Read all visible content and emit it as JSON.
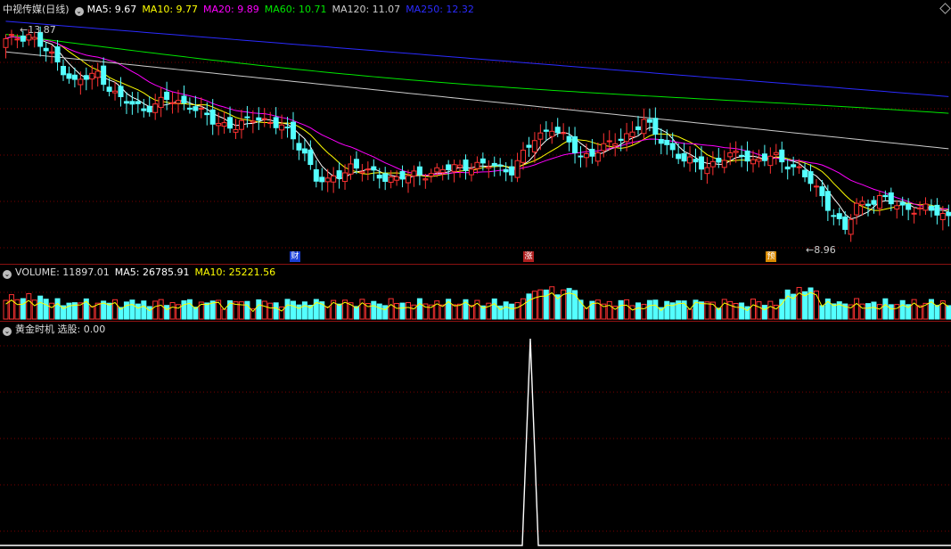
{
  "main_legend": {
    "title": "中视传媒(日线)",
    "ma5": "MA5: 9.67",
    "ma10": "MA10: 9.77",
    "ma20": "MA20: 9.89",
    "ma60": "MA60: 10.71",
    "ma120": "MA120: 11.07",
    "ma250": "MA250: 12.32"
  },
  "volume_legend": {
    "title": "VOLUME: 11897.01",
    "ma5": "MA5: 26785.91",
    "ma10": "MA10: 25221.56"
  },
  "indicator_legend": {
    "title": "黄金时机 选股: 0.00"
  },
  "annotations": {
    "high": "13.87",
    "low": "8.96"
  },
  "events": [
    "财",
    "涨",
    "预"
  ],
  "icons": {
    "collapse": "chevron-circle-icon",
    "corner": "diamond-icon"
  },
  "colors": {
    "up": "#ff3232",
    "down": "#54ffff",
    "ma5": "#ffffff",
    "ma10": "#ffff00",
    "ma20": "#ff00ff",
    "ma60": "#00e600",
    "ma120": "#cccccc",
    "ma250": "#2b2bff",
    "grid": "#7a0000",
    "indicator": "#ffffff"
  },
  "chart_data": [
    {
      "type": "candlestick",
      "series": [
        {
          "name": "MA5",
          "value": 9.67
        },
        {
          "name": "MA10",
          "value": 9.77
        },
        {
          "name": "MA20",
          "value": 9.89
        },
        {
          "name": "MA60",
          "value": 10.71
        },
        {
          "name": "MA120",
          "value": 11.07
        },
        {
          "name": "MA250",
          "value": 12.32
        }
      ],
      "ylim": [
        8.7,
        14.2
      ],
      "highlights": {
        "max": 13.87,
        "min": 8.96
      }
    },
    {
      "type": "bar",
      "series": [
        {
          "name": "VOLUME",
          "value": 11897.01
        },
        {
          "name": "MA5",
          "value": 26785.91
        },
        {
          "name": "MA10",
          "value": 25221.56
        }
      ]
    },
    {
      "type": "line",
      "series": [
        {
          "name": "选股",
          "value": 0.0
        }
      ]
    }
  ]
}
